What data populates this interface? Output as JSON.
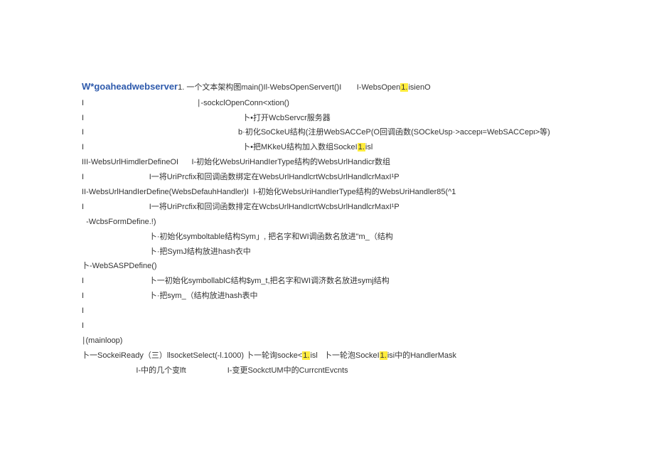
{
  "title": "W*goaheadwebserver",
  "line01_a": "1. 一个文本架构图main()Il-WebsOpenServert()I       I-WebsOpen",
  "line01_b": "1.",
  "line01_c": "isienO",
  "line02": "I                                                    ∣-sockclOpenConn<xtion()",
  "line03": "I                                                                         卜•打开WcbServcr服务器",
  "line04": "I                                                                       b·初化SoCkeU结构(注册WebSACCeP(O回调函数(SOCkeUsp·>accepι=WebSACCepι>等)",
  "line05_a": "I                                                                         卜•把MKkeU结构加入数组SockeI",
  "line05_b": "1.",
  "line05_c": "isl",
  "line06": "III-WebsUrlHimdlerDefineOI      I-初始化WebsUriHandIerType结构的WebsUrlHandicr数组",
  "line07": "I                              I一将UriPrcfix和回调函数绑定在WebsUrlHandlcrtWcbsUrlHandlcrMaxI¹P",
  "line08": "II-WebsUrlHandIerDefine(WebsDefauhHandler)I  I-初始化WebsUriHandIerType结构的WebsUriHandler85(^1",
  "line09": "I                              I一将UriPrcfix和回词函数排定在WcbsUrlHandIcrtWcbsUrlHandlcrMaxI¹P",
  "line10": "",
  "line11": "",
  "line12": "  -WcbsFormDefine.!)",
  "line13": "                               卜·初始化symboltable结构Sym」, 把名字和WI调函数名放进\"m_（结构",
  "line14": "                               卜·把SymJ结构放进hash衣中",
  "line15": "卜-WebSASPDefine()",
  "line16": "I                              卜一初始化symbollablC结构$ym_t,把名字和WI调济数名放进symj结构",
  "line17": "I                              卜·把sym_（结构放进hash表中",
  "line18": "I",
  "line19": "I",
  "line20": "∣(mainloop)",
  "line21_a": "卜一SockeiReady（三）llsocketSelect(-l.1000) 卜一轮询socke<",
  "line21_b": "1.",
  "line21_c": "isl   卜一轮泡SockeI",
  "line21_d": "1.",
  "line21_e": "isi中的HandlerMask",
  "line22": "                         I-中的几个变lft                   I-变更SockctUM中的CurrcntEvcnts"
}
